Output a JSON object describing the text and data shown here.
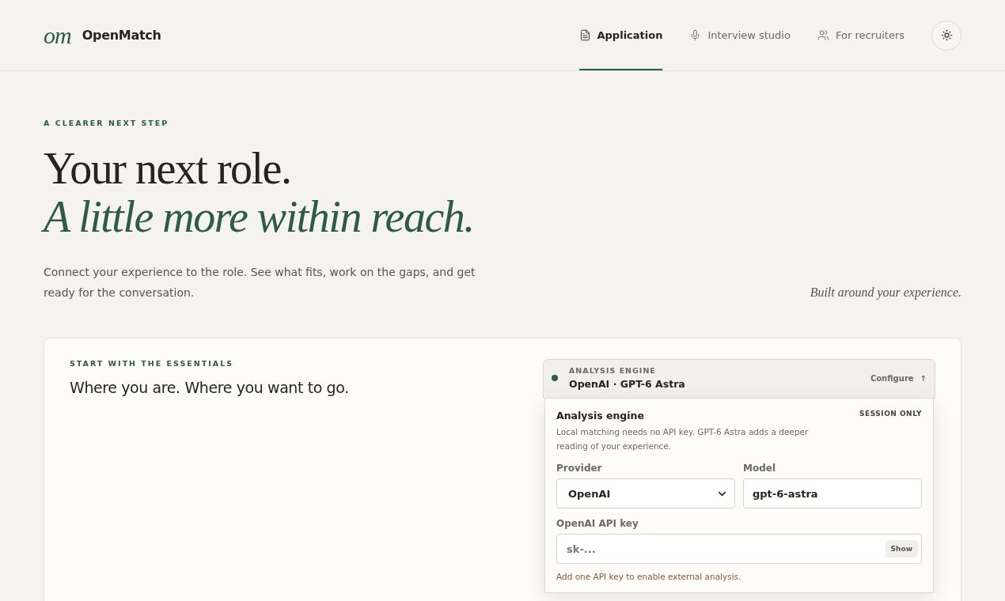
{
  "brand": {
    "mark": "om",
    "name": "OpenMatch"
  },
  "nav": [
    {
      "label": "Application",
      "selected": true
    },
    {
      "label": "Interview studio",
      "selected": false
    },
    {
      "label": "For recruiters",
      "selected": false
    }
  ],
  "hero": {
    "eyebrow": "A CLEARER NEXT STEP",
    "title": "Your next role.",
    "title_accent": "A little more within reach.",
    "intro": "Connect your experience to the role. See what fits, work on the gaps, and get ready for the conversation.",
    "aside": "Built around your experience."
  },
  "card": {
    "eyebrow": "START WITH THE ESSENTIALS",
    "title": "Where you are. Where you want to go."
  },
  "engine": {
    "label": "ANALYSIS ENGINE",
    "value": "OpenAI · GPT-6 Astra",
    "configure": "Configure",
    "configure_arrow": "↑",
    "expanded": true,
    "panel": {
      "title": "Analysis engine",
      "badge": "SESSION ONLY",
      "description": "Local matching needs no API key. GPT-6 Astra adds a deeper reading of your experience.",
      "provider": {
        "label": "Provider",
        "value": "OpenAI"
      },
      "model": {
        "label": "Model",
        "value": "gpt-6-astra"
      },
      "api_key": {
        "label": "OpenAI API key",
        "placeholder": "sk-...",
        "toggle": "Show"
      },
      "hint": "Add one API key to enable external analysis."
    }
  }
}
